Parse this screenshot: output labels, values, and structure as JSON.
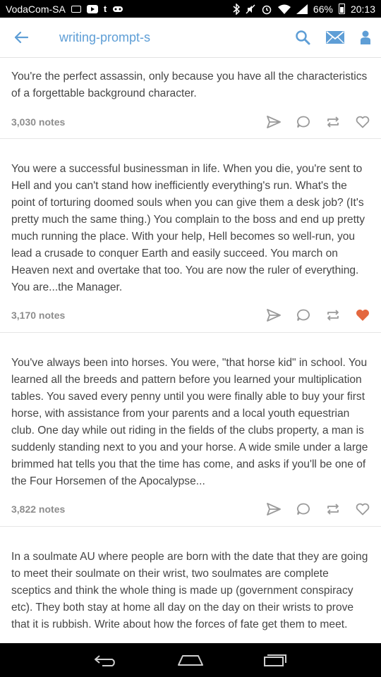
{
  "status_bar": {
    "carrier": "VodaCom-SA",
    "battery": "66%",
    "time": "20:13"
  },
  "app_bar": {
    "blog_name": "writing-prompt-s",
    "accent_color": "#5e9ed6"
  },
  "posts": [
    {
      "text": "You're the perfect assassin, only because you have all the characteristics of a forgettable background character.",
      "notes": "3,030 notes",
      "liked": false
    },
    {
      "text": "You were a successful businessman in life. When you die, you're sent to Hell and you can't stand how inefficiently everything's run. What's the point of torturing doomed souls when you can give them a desk job? (It's pretty much the same thing.) You complain to the boss and end up pretty much running the place. With your help, Hell becomes so well-run, you lead a crusade to conquer Earth and easily succeed. You march on Heaven next and overtake that too. You are now the ruler of everything. You are...the Manager.",
      "notes": "3,170 notes",
      "liked": true
    },
    {
      "text": "You've always been into horses. You were, \"that horse kid\" in school. You learned all the breeds and pattern before you learned your multiplication tables. You saved every penny until you were finally able to buy your first horse, with assistance from your parents and a local youth equestrian club. One day while out riding in the fields of the clubs property, a man is suddenly standing next to you and your horse. A wide smile under a large brimmed hat tells you that the time has come, and asks if you'll be one of the Four Horsemen of the Apocalypse...",
      "notes": "3,822 notes",
      "liked": false
    },
    {
      "text": "In a soulmate AU where people are born with the date that they are going to meet their soulmate on their wrist, two soulmates are complete sceptics and think the whole thing is made up (government conspiracy etc). They both stay at home all day on the day on their wrists to prove that it is rubbish. Write about how the forces of fate get them to meet."
    }
  ],
  "colors": {
    "liked_heart": "#e4683f",
    "icon_gray": "#9a9a9a"
  }
}
